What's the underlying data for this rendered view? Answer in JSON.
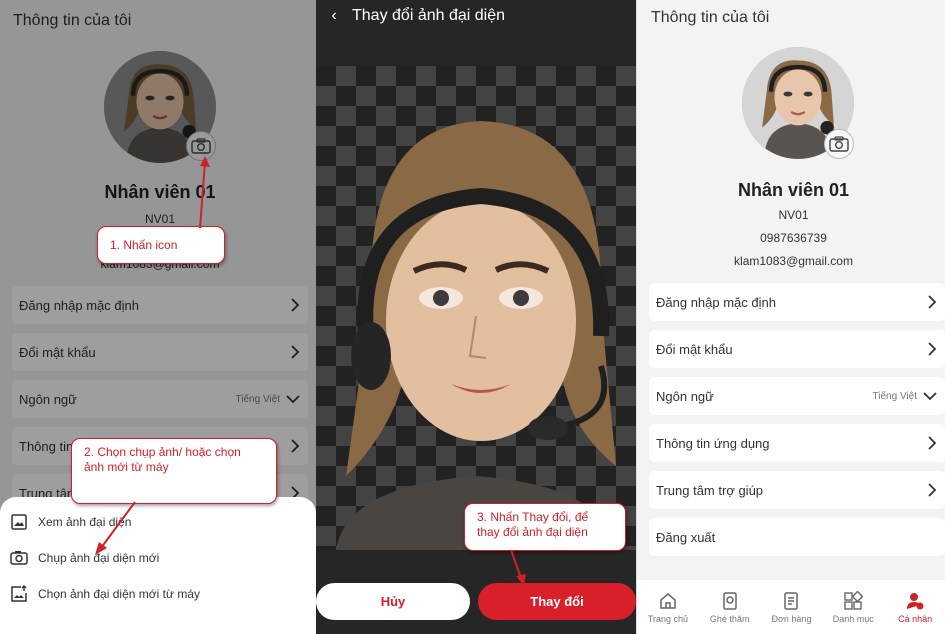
{
  "screen_title": "Thông tin của tôi",
  "user": {
    "name": "Nhân viên 01",
    "code": "NV01",
    "phone": "0987636739",
    "email": "klam1083@gmail.com",
    "email_partial": "klam1083@gmail.com"
  },
  "menu": {
    "default_login": "Đăng nhập mặc định",
    "change_password": "Đổi mật khẩu",
    "language": "Ngôn ngữ",
    "language_value": "Tiếng Việt",
    "app_info": "Thông tin ứng dụng",
    "app_info_partial": "Thông tin",
    "help_center": "Trung tâm trợ giúp",
    "help_center_partial": "Trung tâm",
    "logout": "Đăng xuất"
  },
  "sheet": {
    "view": "Xem ảnh đại diện",
    "capture": "Chụp ảnh đại diện mới",
    "choose": "Chọn ảnh đại diện mới từ máy"
  },
  "editor": {
    "title": "Thay đổi ảnh đại diện",
    "back": "‹",
    "cancel": "Hủy",
    "change": "Thay đổi"
  },
  "callouts": {
    "step1": "1. Nhấn icon",
    "step2": "2. Chọn chụp ảnh/ hoặc chọn ảnh mới từ máy",
    "step3": "3. Nhấn Thay đổi, để thay đổi ảnh đại diện"
  },
  "tabs": [
    {
      "label": "Trang chủ",
      "icon": "home-icon"
    },
    {
      "label": "Ghé thăm",
      "icon": "visit-icon"
    },
    {
      "label": "Đơn hàng",
      "icon": "order-icon"
    },
    {
      "label": "Danh mục",
      "icon": "category-icon"
    },
    {
      "label": "Cá nhân",
      "icon": "profile-icon"
    }
  ],
  "colors": {
    "accent": "#d81f2a",
    "callout": "#d0202a",
    "background": "#f3f3f3",
    "dark": "#262626"
  }
}
